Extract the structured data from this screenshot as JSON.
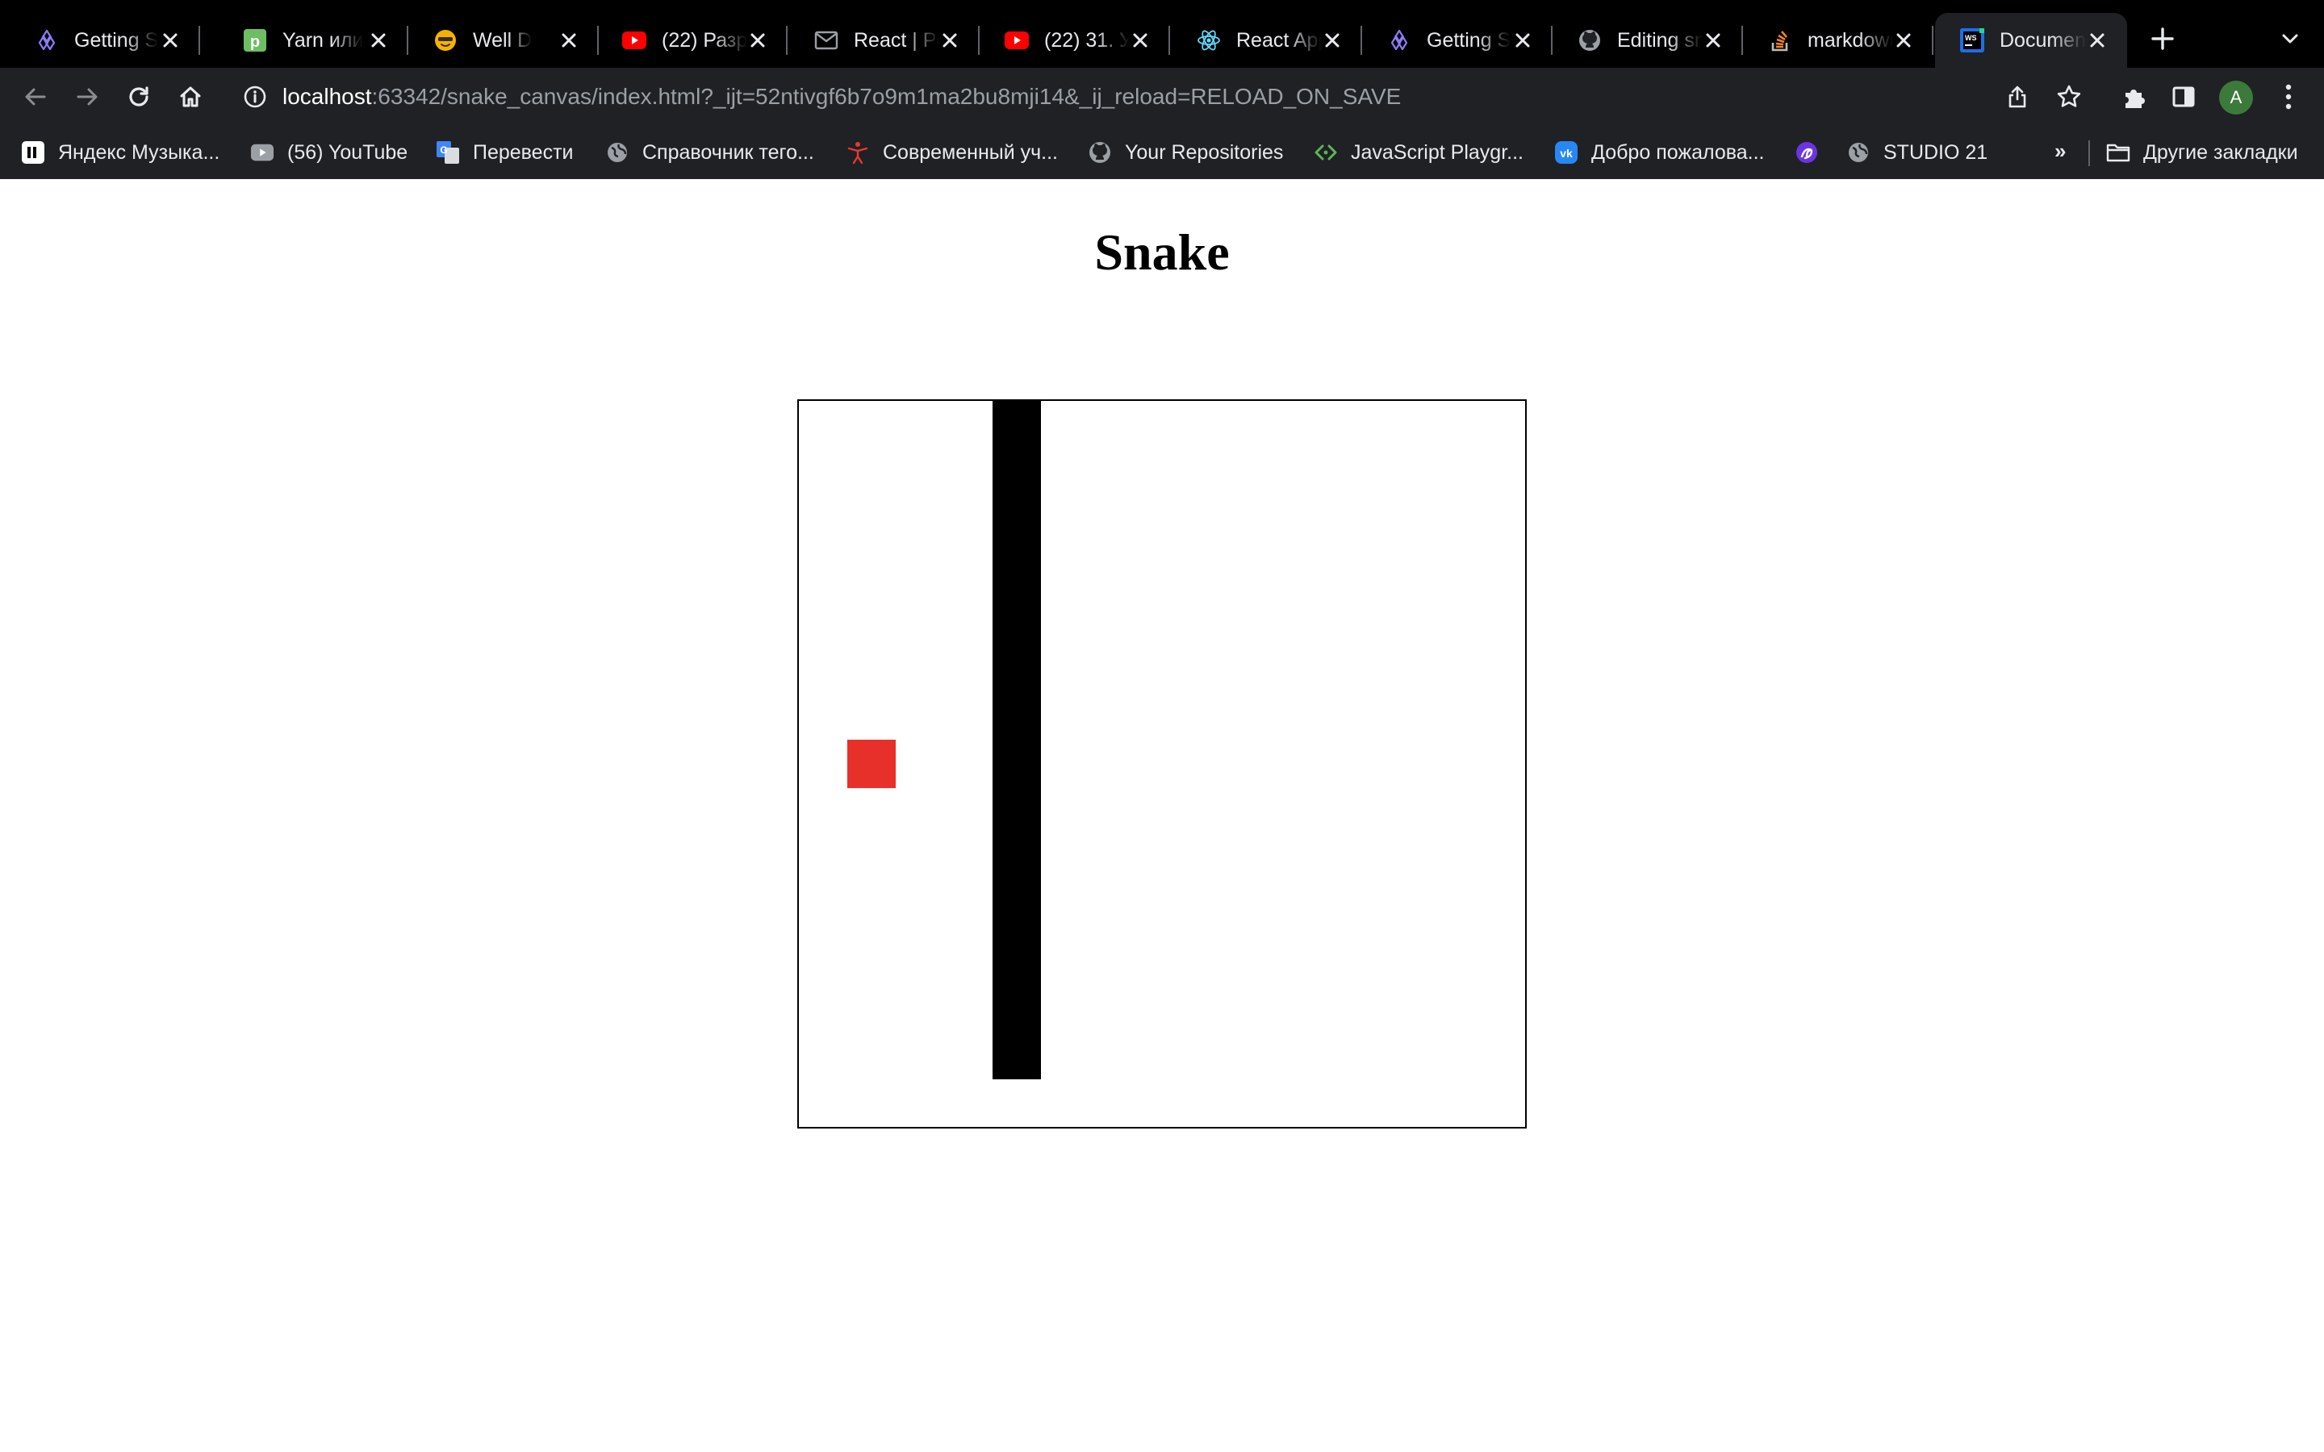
{
  "browser": {
    "tabs": [
      {
        "title": "Getting S",
        "icon": "design-system-icon",
        "icon_color": "#8b7cf6",
        "active": false
      },
      {
        "title": "Yarn или",
        "icon": "p-logo-icon",
        "icon_color": "#6dbe62",
        "active": false
      },
      {
        "title": "Well D",
        "icon": "emoji-icon",
        "icon_color": "#f5b301",
        "active": false
      },
      {
        "title": "(22) Разр",
        "icon": "youtube-icon",
        "icon_color": "#ff0000",
        "active": false
      },
      {
        "title": "React | Pe",
        "icon": "mail-icon",
        "icon_color": "#9aa0a6",
        "active": false
      },
      {
        "title": "(22) 31. У",
        "icon": "youtube-icon",
        "icon_color": "#ff0000",
        "active": false
      },
      {
        "title": "React App",
        "icon": "react-icon",
        "icon_color": "#61dafb",
        "active": false
      },
      {
        "title": "Getting S",
        "icon": "design-system-icon",
        "icon_color": "#8b7cf6",
        "active": false
      },
      {
        "title": "Editing sn",
        "icon": "github-icon",
        "icon_color": "#9aa0a6",
        "active": false
      },
      {
        "title": "markdown",
        "icon": "stackoverflow-icon",
        "icon_color": "#f48024",
        "active": false
      },
      {
        "title": "Documen",
        "icon": "webstorm-icon",
        "icon_color": "#21d789",
        "active": true
      }
    ],
    "address": {
      "host": "localhost",
      "rest": ":63342/snake_canvas/index.html?_ijt=52ntivgf6b7o9m1ma2bu8mji14&_ij_reload=RELOAD_ON_SAVE"
    },
    "profile_initial": "A",
    "bookmarks": [
      {
        "label": "Яндекс Музыка...",
        "icon": "yandex-music-icon"
      },
      {
        "label": "(56) YouTube",
        "icon": "youtube-icon"
      },
      {
        "label": "Перевести",
        "icon": "translate-icon"
      },
      {
        "label": "Справочник тего...",
        "icon": "globe-icon"
      },
      {
        "label": "Современный уч...",
        "icon": "figure-icon"
      },
      {
        "label": "Your Repositories",
        "icon": "github-icon"
      },
      {
        "label": "JavaScript Playgr...",
        "icon": "code-icon"
      },
      {
        "label": "Добро пожалова...",
        "icon": "vk-icon"
      },
      {
        "label": "",
        "icon": "purple-logo-icon"
      },
      {
        "label": "STUDIO 21",
        "icon": "globe-icon"
      }
    ],
    "bookmarks_overflow": "»",
    "other_bookmarks": "Другие закладки",
    "colors": {
      "frame": "#000000",
      "toolbar": "#202124",
      "text": "#e8eaed",
      "url_muted": "#9aa0a6"
    }
  },
  "page": {
    "title": "Snake",
    "game": {
      "grid_cells": 15,
      "snake_cells": [
        [
          4,
          0
        ],
        [
          4,
          1
        ],
        [
          4,
          2
        ],
        [
          4,
          3
        ],
        [
          4,
          4
        ],
        [
          4,
          5
        ],
        [
          4,
          6
        ],
        [
          4,
          7
        ],
        [
          4,
          8
        ],
        [
          4,
          9
        ],
        [
          4,
          10
        ],
        [
          4,
          11
        ],
        [
          4,
          12
        ],
        [
          4,
          13
        ]
      ],
      "food_cell": [
        1,
        7
      ],
      "snake_color": "#000000",
      "food_color": "#e8302a"
    }
  }
}
